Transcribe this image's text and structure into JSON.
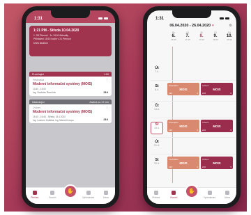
{
  "left": {
    "status_time": "1:31",
    "info_card": {
      "date": "1:21 PM - Středa 10.04.2020",
      "rows": [
        [
          "1. 2B Přenoct",
          "1x 1/100 Aktuality"
        ],
        [
          "Přihlášení 15/15 hodin v 21 Přenoct"
        ],
        [
          "Dnes studium"
        ]
      ]
    },
    "now": {
      "header": "Probíhající",
      "header_right": "1:50",
      "type": "Přednáška",
      "title": "Moderní informační systémy (MOIS)",
      "time": "13:30 - 15:00",
      "teacher": "Ing. Vladislav Řezníček",
      "room": "216"
    },
    "next": {
      "header": "Následující",
      "header_right": "Začíná za 17 min",
      "type": "Cvičení",
      "title": "Moderní informační systémy (MOIS)",
      "time": "15:15 - 16:45 - Středa, 15.4.2020",
      "teacher": "Ing. Lubomír Hrdlička, Ing. Michal Kroupa",
      "room": "216"
    },
    "tabs": [
      "Přehled",
      "Rozvrh",
      "Profil",
      "Vyhledávání",
      "Menu"
    ],
    "fab_icon": "hand-icon"
  },
  "right": {
    "status_time": "1:31",
    "range": "06.04.2020 - 26.04.2020",
    "days": [
      {
        "abbr": "Po",
        "num": "6.",
        "time": "15:45"
      },
      {
        "abbr": "Út",
        "num": "7.",
        "time": "17:15"
      },
      {
        "abbr": "St",
        "num": "8.",
        "time": "17:00"
      },
      {
        "abbr": "Čt",
        "num": "9.",
        "time": "18:00"
      },
      {
        "abbr": "Pá",
        "num": "10.",
        "time": "20:30"
      }
    ],
    "rows": [
      {
        "day": "Út",
        "date": "7.4."
      },
      {
        "day": "St",
        "date": "8.4."
      },
      {
        "day": "Čt",
        "date": "14.4."
      },
      {
        "day": "St",
        "date": "15.4."
      },
      {
        "day": "Út",
        "date": "21.4."
      },
      {
        "day": "St",
        "date": "22.4."
      }
    ],
    "event": {
      "type_lecture": "Přednáška",
      "type_exercise": "Cvičení",
      "name": "MOIS",
      "room": "216",
      "count_lecture": "2",
      "count_exercise": "5"
    },
    "tabs": [
      "Přehled",
      "Rozvrh",
      "Profil",
      "Vyhledávání",
      "Menu"
    ],
    "fab_icon": "hand-icon"
  }
}
